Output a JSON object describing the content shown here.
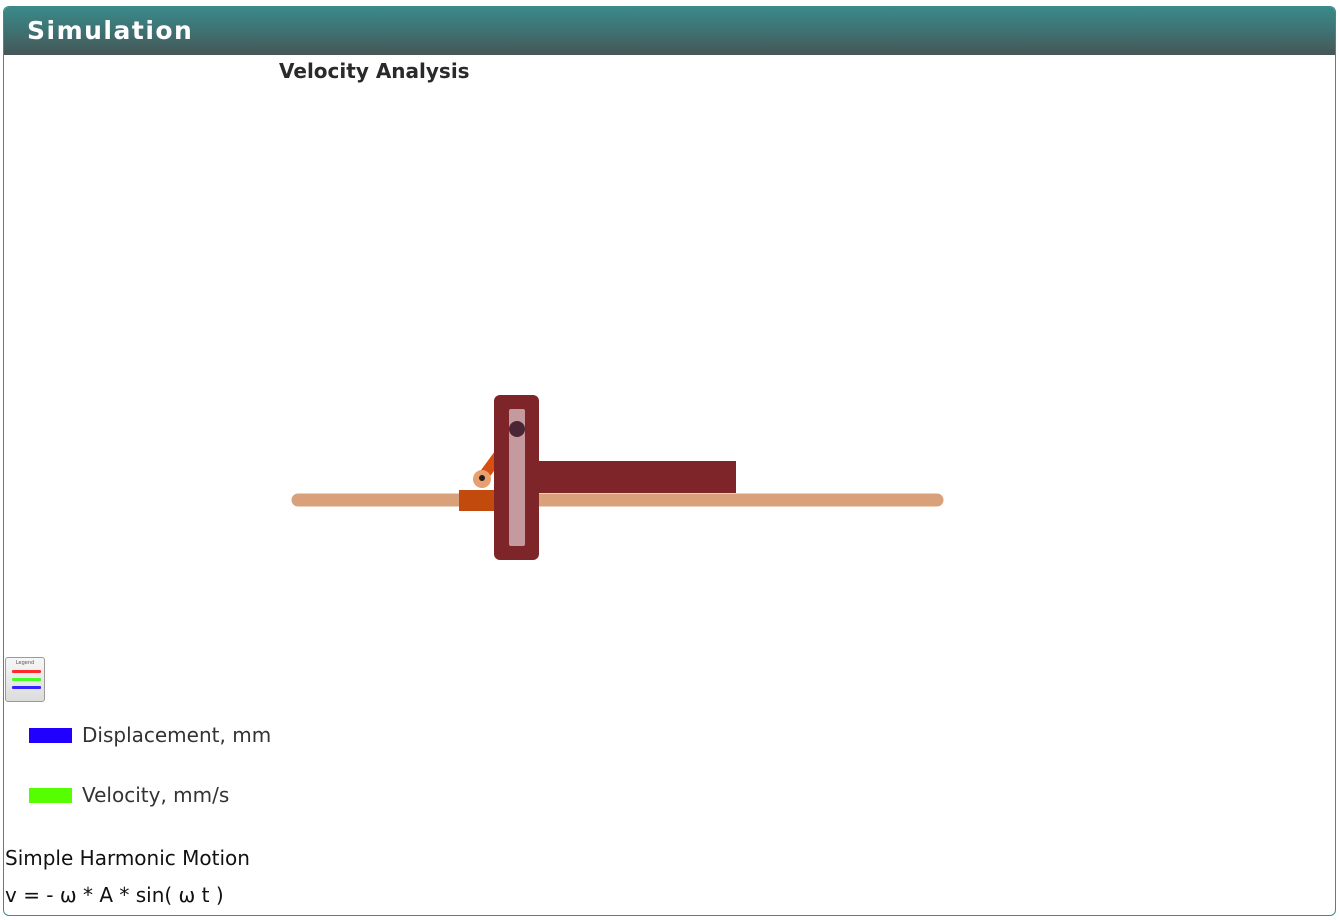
{
  "header": {
    "title": "Simulation"
  },
  "simulation": {
    "title": "Velocity Analysis",
    "colors": {
      "rail": "#d9a17a",
      "frame": "#7e2529",
      "slot": "#c59a9e",
      "crank": "#d84f0f",
      "block": "#c24a0c",
      "pin": "#4a2535"
    }
  },
  "legend": {
    "toggle_icon": "legend-icon",
    "items": [
      {
        "label": "Displacement, mm",
        "color": "#2200ff"
      },
      {
        "label": "Velocity, mm/s",
        "color": "#55ff00"
      }
    ],
    "toggle_line_colors": [
      "#ff2a2a",
      "#44ff22",
      "#3322ff"
    ]
  },
  "info": {
    "motion_type": "Simple Harmonic Motion",
    "equation": "v = - ω * A * sin( ω t )"
  }
}
